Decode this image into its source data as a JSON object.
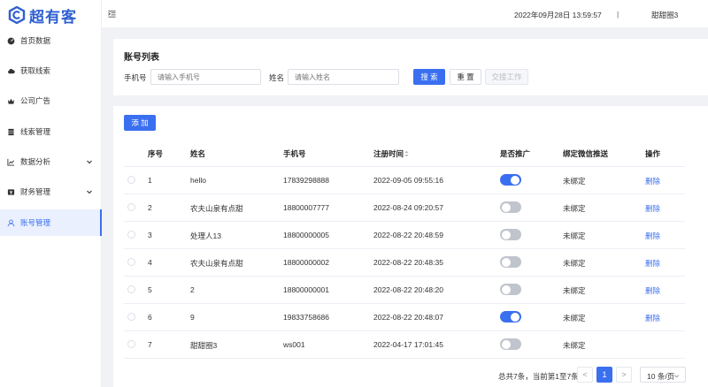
{
  "app": {
    "name": "超有客"
  },
  "header": {
    "datetime": "2022年09月28日 13:59:57",
    "separator": "|",
    "username": "甜甜圈3"
  },
  "sidebar": {
    "items": [
      {
        "label": "首页数据",
        "icon": "dashboard-icon",
        "active": false
      },
      {
        "label": "获取线索",
        "icon": "cloud-icon",
        "active": false
      },
      {
        "label": "公司广告",
        "icon": "crown-icon",
        "active": false
      },
      {
        "label": "线索管理",
        "icon": "database-icon",
        "active": false
      },
      {
        "label": "数据分析",
        "icon": "chart-icon",
        "active": false,
        "expandable": true
      },
      {
        "label": "财务管理",
        "icon": "finance-icon",
        "active": false,
        "expandable": true
      },
      {
        "label": "账号管理",
        "icon": "user-icon",
        "active": true
      }
    ]
  },
  "search": {
    "title": "账号列表",
    "phone_label": "手机号",
    "phone_placeholder": "请输入手机号",
    "name_label": "姓名",
    "name_placeholder": "请输入姓名",
    "search_button": "搜 索",
    "reset_button": "重 置",
    "handover_button": "交接工作"
  },
  "table": {
    "add_button": "添 加",
    "columns": [
      "序号",
      "姓名",
      "手机号",
      "注册时间",
      "是否推广",
      "绑定微信推送",
      "操作"
    ],
    "rows": [
      {
        "index": "1",
        "name": "hello",
        "phone": "17839298888",
        "registered": "2022-09-05 09:55:16",
        "promote": true,
        "wechat": "未绑定",
        "action": "删除"
      },
      {
        "index": "2",
        "name": "农夫山泉有点甜",
        "phone": "18800007777",
        "registered": "2022-08-24 09:20:57",
        "promote": false,
        "wechat": "未绑定",
        "action": "删除"
      },
      {
        "index": "3",
        "name": "处理人13",
        "phone": "18800000005",
        "registered": "2022-08-22 20:48:59",
        "promote": false,
        "wechat": "未绑定",
        "action": "删除"
      },
      {
        "index": "4",
        "name": "农夫山泉有点甜",
        "phone": "18800000002",
        "registered": "2022-08-22 20:48:35",
        "promote": false,
        "wechat": "未绑定",
        "action": "删除"
      },
      {
        "index": "5",
        "name": "2",
        "phone": "18800000001",
        "registered": "2022-08-22 20:48:20",
        "promote": false,
        "wechat": "未绑定",
        "action": "删除"
      },
      {
        "index": "6",
        "name": "9",
        "phone": "19833758686",
        "registered": "2022-08-22 20:48:07",
        "promote": true,
        "wechat": "未绑定",
        "action": "删除"
      },
      {
        "index": "7",
        "name": "甜甜圈3",
        "phone": "ws001",
        "registered": "2022-04-17 17:01:45",
        "promote": false,
        "wechat": "未绑定",
        "action": ""
      }
    ]
  },
  "pagination": {
    "summary": "总共7条，当前第1至7条",
    "prev": "<",
    "current_page": "1",
    "next": ">",
    "page_size": "10 条/页"
  },
  "colors": {
    "primary": "#3a6ff0",
    "switch_off": "#c0c4cc",
    "background": "#f0f2f5"
  }
}
